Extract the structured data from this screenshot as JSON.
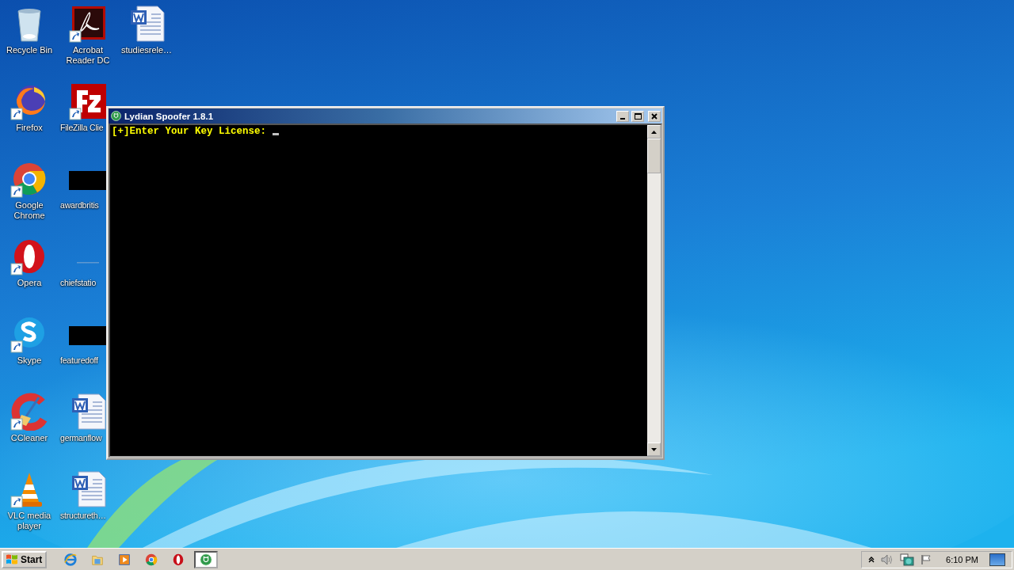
{
  "desktop_icons": [
    {
      "label": "Recycle Bin",
      "kind": "recycle",
      "shortcut": false
    },
    {
      "label": "Firefox",
      "kind": "firefox",
      "shortcut": true
    },
    {
      "label": "Google Chrome",
      "kind": "chrome",
      "shortcut": true
    },
    {
      "label": "Opera",
      "kind": "opera",
      "shortcut": true
    },
    {
      "label": "Skype",
      "kind": "skype",
      "shortcut": true
    },
    {
      "label": "CCleaner",
      "kind": "ccleaner",
      "shortcut": true
    },
    {
      "label": "VLC media player",
      "kind": "vlc",
      "shortcut": true
    },
    {
      "label": "Acrobat Reader DC",
      "kind": "acrobat",
      "shortcut": true
    },
    {
      "label": "FileZilla Clie",
      "kind": "filezilla",
      "shortcut": true
    },
    {
      "label": "awardbritis",
      "kind": "dark",
      "shortcut": false
    },
    {
      "label": "chiefstatio",
      "kind": "faint",
      "shortcut": false
    },
    {
      "label": "featuredoff",
      "kind": "dark",
      "shortcut": false
    },
    {
      "label": "germanflow",
      "kind": "word",
      "shortcut": false
    },
    {
      "label": "structureth…",
      "kind": "word",
      "shortcut": false
    },
    {
      "label": "studiesrele…",
      "kind": "word",
      "shortcut": false
    }
  ],
  "window": {
    "title": "Lydian Spoofer 1.8.1",
    "console_lines": [
      "[+]Enter Your Key License: "
    ]
  },
  "taskbar": {
    "start": "Start",
    "items": [
      {
        "kind": "ie",
        "selected": false
      },
      {
        "kind": "folder",
        "selected": false
      },
      {
        "kind": "media",
        "selected": false
      },
      {
        "kind": "chrome",
        "selected": false
      },
      {
        "kind": "opera",
        "selected": false
      },
      {
        "kind": "shield",
        "selected": true
      }
    ],
    "clock": "6:10 PM"
  }
}
